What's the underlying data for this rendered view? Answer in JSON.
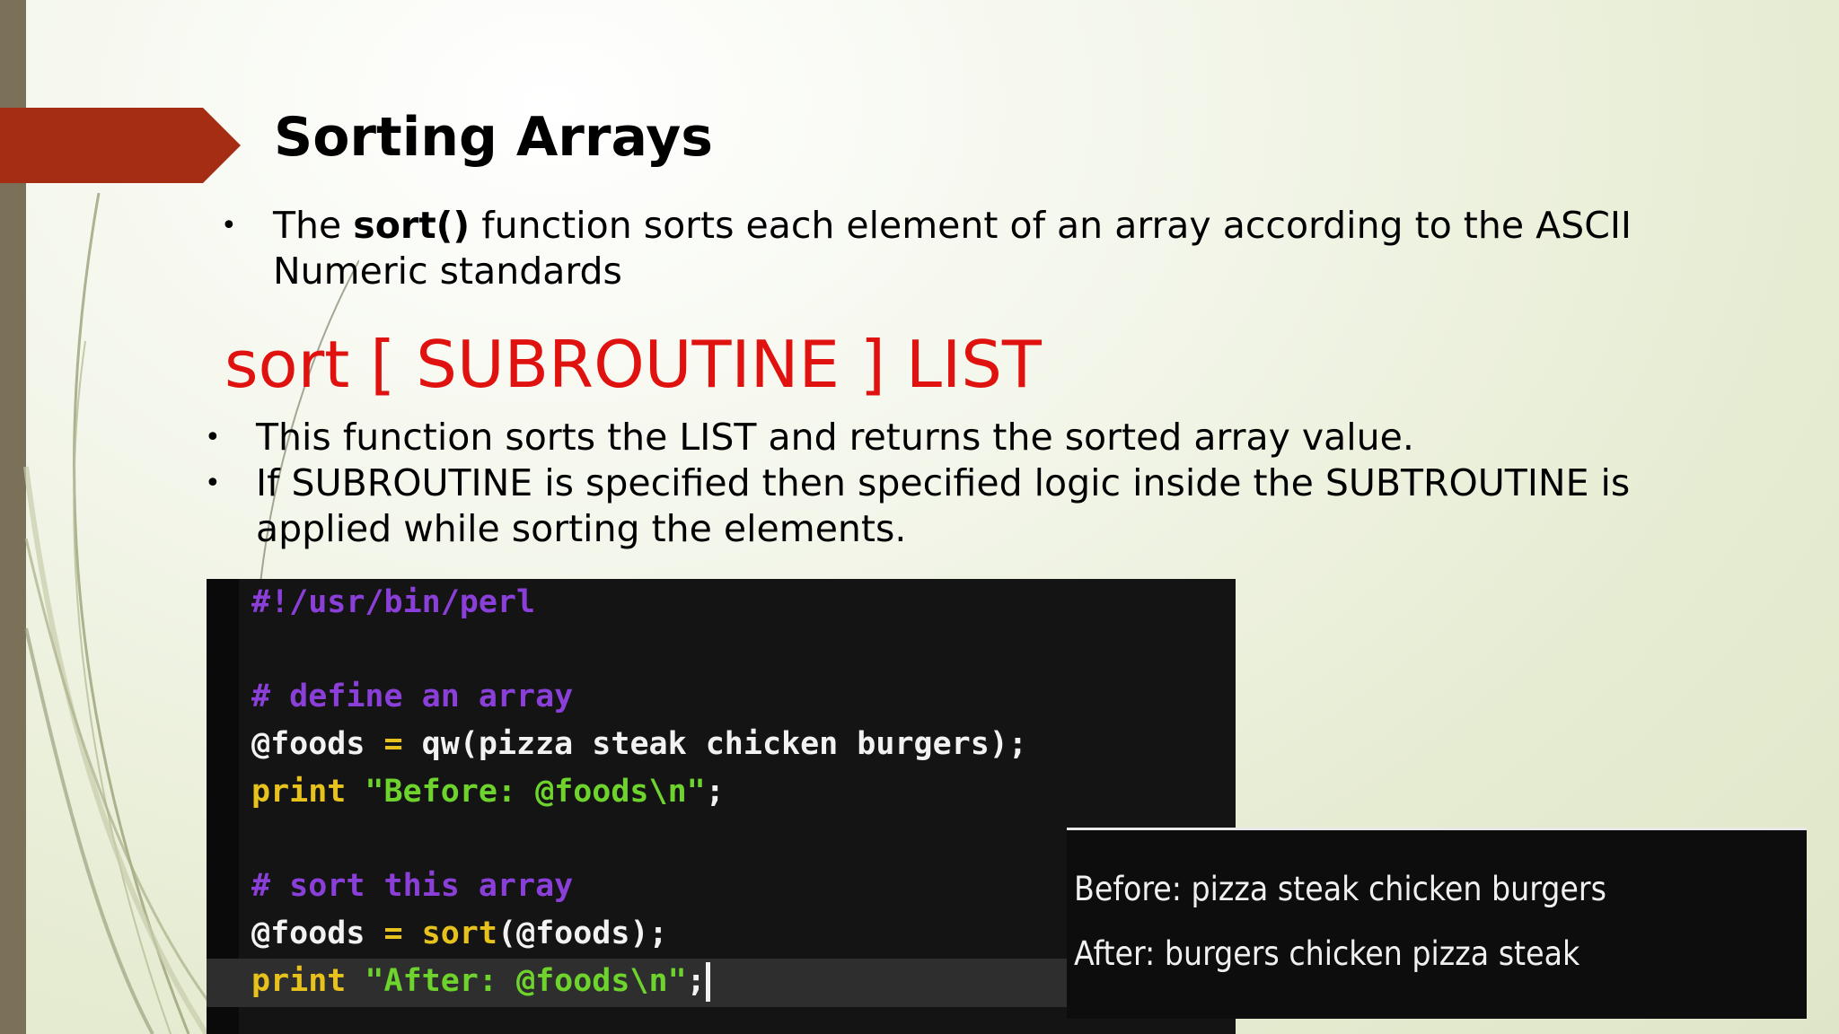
{
  "slide": {
    "title": "Sorting Arrays",
    "bullet1_pre": "The ",
    "bullet1_bold": "sort()",
    "bullet1_post": " function sorts each element of an array according to the ASCII Numeric standards",
    "syntax": "sort [ SUBROUTINE ] LIST",
    "bullet2": "This function sorts the LIST and returns the sorted array value.",
    "bullet3": "If  SUBROUTINE is specified then specified logic inside the SUBTROUTINE is applied while sorting the elements.",
    "bullet_glyph": "•"
  },
  "code": {
    "shebang": "#!/usr/bin/perl",
    "comment1": "# define an array",
    "l3_var": "@foods",
    "l3_eq": " = ",
    "l3_rest": "qw(pizza steak chicken burgers);",
    "l4_kw": "print",
    "l4_str": " \"Before: @foods\\n\"",
    "l4_end": ";",
    "comment2": "# sort this array",
    "l6_var": "@foods",
    "l6_eq": " = ",
    "l6_fn": "sort",
    "l6_rest": "(@foods);",
    "l7_kw": "print",
    "l7_str": " \"After: @foods\\n\"",
    "l7_end": ";"
  },
  "output": {
    "line1": "Before: pizza steak chicken burgers",
    "line2": "After: burgers chicken pizza steak"
  },
  "colors": {
    "accent_arrow": "#a52d14",
    "syntax_red": "#e0120f",
    "left_bar": "#7a7158",
    "comment": "#8b3fd9",
    "keyword": "#e8c21c",
    "string": "#6ed32c"
  }
}
